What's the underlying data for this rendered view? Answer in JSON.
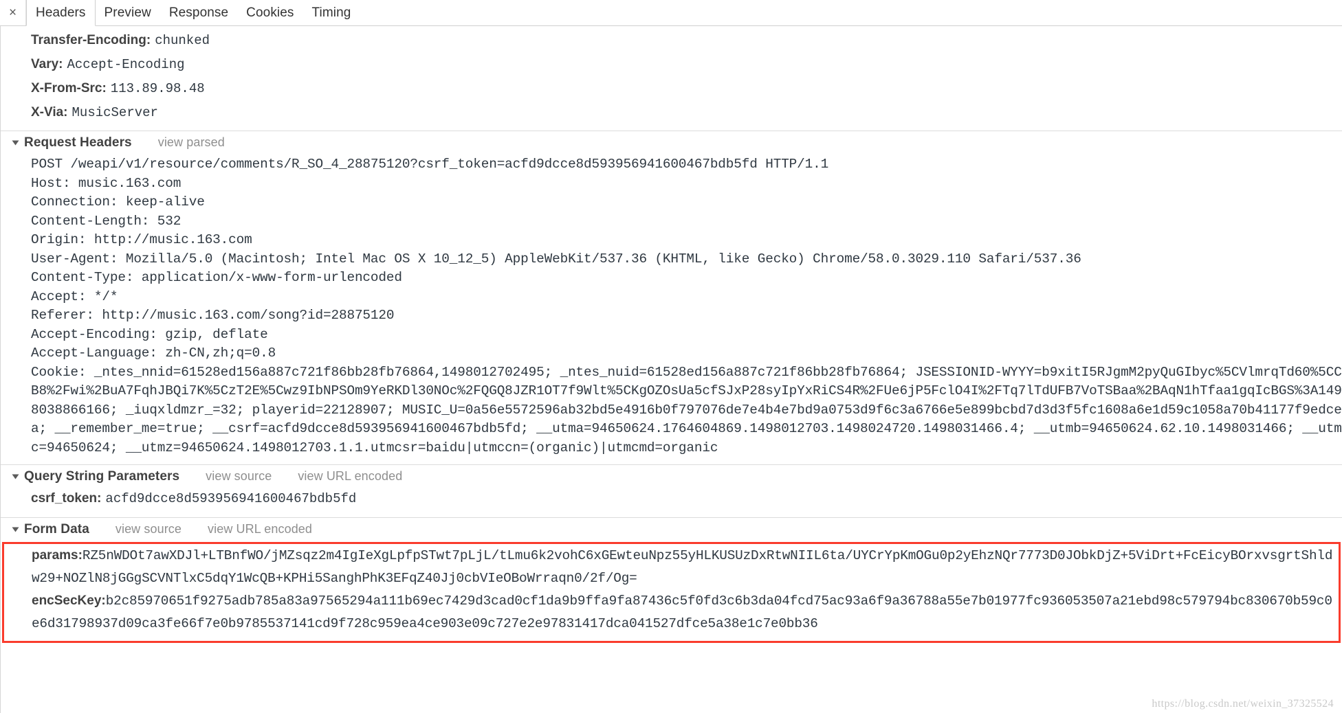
{
  "tabs": {
    "close_icon": "close-icon",
    "close_glyph": "×",
    "items": [
      {
        "label": "Headers",
        "selected": true
      },
      {
        "label": "Preview",
        "selected": false
      },
      {
        "label": "Response",
        "selected": false
      },
      {
        "label": "Cookies",
        "selected": false
      },
      {
        "label": "Timing",
        "selected": false
      }
    ]
  },
  "response_headers_tail": [
    {
      "name": "Transfer-Encoding:",
      "value": "chunked"
    },
    {
      "name": "Vary:",
      "value": "Accept-Encoding"
    },
    {
      "name": "X-From-Src:",
      "value": "113.89.98.48"
    },
    {
      "name": "X-Via:",
      "value": "MusicServer"
    }
  ],
  "request_headers": {
    "title": "Request Headers",
    "view_parsed": "view parsed",
    "raw": "POST /weapi/v1/resource/comments/R_SO_4_28875120?csrf_token=acfd9dcce8d593956941600467bdb5fd HTTP/1.1\nHost: music.163.com\nConnection: keep-alive\nContent-Length: 532\nOrigin: http://music.163.com\nUser-Agent: Mozilla/5.0 (Macintosh; Intel Mac OS X 10_12_5) AppleWebKit/537.36 (KHTML, like Gecko) Chrome/58.0.3029.110 Safari/537.36\nContent-Type: application/x-www-form-urlencoded\nAccept: */*\nReferer: http://music.163.com/song?id=28875120\nAccept-Encoding: gzip, deflate\nAccept-Language: zh-CN,zh;q=0.8\nCookie: _ntes_nnid=61528ed156a887c721f86bb28fb76864,1498012702495; _ntes_nuid=61528ed156a887c721f86bb28fb76864; JSESSIONID-WYYY=b9xitI5RJgmM2pyQuGIbyc%5CVlmrqTd60%5CCB8%2Fwi%2BuA7FqhJBQi7K%5CzT2E%5Cwz9IbNPSOm9YeRKDl30NOc%2FQGQ8JZR1OT7f9Wlt%5CKgOZOsUa5cfSJxP28syIpYxRiCS4R%2FUe6jP5FclO4I%2FTq7lTdUFB7VoTSBaa%2BAqN1hTfaa1gqIcBGS%3A1498038866166; _iuqxldmzr_=32; playerid=22128907; MUSIC_U=0a56e5572596ab32bd5e4916b0f797076de7e4b4e7bd9a0753d9f6c3a6766e5e899bcbd7d3d3f5fc1608a6e1d59c1058a70b41177f9edcea; __remember_me=true; __csrf=acfd9dcce8d593956941600467bdb5fd; __utma=94650624.1764604869.1498012703.1498024720.1498031466.4; __utmb=94650624.62.10.1498031466; __utmc=94650624; __utmz=94650624.1498012703.1.1.utmcsr=baidu|utmccn=(organic)|utmcmd=organic"
  },
  "query_string_parameters": {
    "title": "Query String Parameters",
    "view_source": "view source",
    "view_url_encoded": "view URL encoded",
    "params": [
      {
        "name": "csrf_token:",
        "value": "acfd9dcce8d593956941600467bdb5fd"
      }
    ]
  },
  "form_data": {
    "title": "Form Data",
    "view_source": "view source",
    "view_url_encoded": "view URL encoded",
    "highlight_color": "#fa3c2d",
    "params_label": "params:",
    "params_value": "RZ5nWDOt7awXDJl+LTBnfWO/jMZsqz2m4IgIeXgLpfpSTwt7pLjL/tLmu6k2vohC6xGEwteuNpz55yHLKUSUzDxRtwNIIL6ta/UYCrYpKmOGu0p2yEhzNQr7773D0JObkDjZ+5ViDrt+FcEicyBOrxvsgrtShldw29+NOZlN8jGGgSCVNTlxC5dqY1WcQB+KPHi5SanghPhK3EFqZ40Jj0cbVIeOBoWrraqn0/2f/Og=",
    "encseckey_label": "encSecKey:",
    "encseckey_value": "b2c85970651f9275adb785a83a97565294a111b69ec7429d3cad0cf1da9b9ffa9fa87436c5f0fd3c6b3da04fcd75ac93a6f9a36788a55e7b01977fc936053507a21ebd98c579794bc830670b59c0e6d31798937d09ca3fe66f7e0b9785537141cd9f728c959ea4ce903e09c727e2e97831417dca041527dfce5a38e1c7e0bb36"
  },
  "watermark": "https://blog.csdn.net/weixin_37325524"
}
